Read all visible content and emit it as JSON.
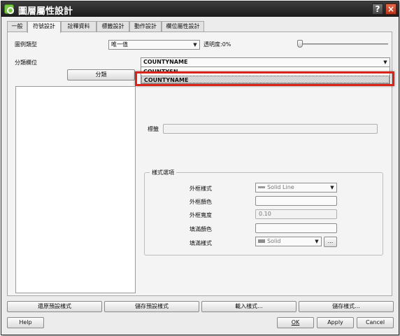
{
  "window": {
    "title": "圖層屬性設計",
    "help_glyph": "?",
    "close_glyph": "×",
    "app_icon": "qgis-logo-icon"
  },
  "tabs": [
    {
      "label": "一般",
      "active": false
    },
    {
      "label": "符號設計",
      "active": true
    },
    {
      "label": "詮釋資料",
      "active": false
    },
    {
      "label": "標籤設計",
      "active": false
    },
    {
      "label": "動作設計",
      "active": false
    },
    {
      "label": "欄位屬性設計",
      "active": false
    }
  ],
  "symbology": {
    "legend_type_label": "圖例類型",
    "legend_type_value": "唯一值",
    "transparency_label": "透明度:0%",
    "transparency_value": 0,
    "classification_field_label": "分類欄位",
    "classify_button": "分類",
    "field_combo_value": "COUNTYNAME",
    "field_options": [
      "COUNTYSN",
      "COUNTYNAME"
    ],
    "selected_option_index": 1,
    "label_label": "標籤",
    "label_value": ""
  },
  "style_options": {
    "group_title": "樣式選項",
    "outline_style_label": "外框樣式",
    "outline_style_value": "Solid Line",
    "outline_color_label": "外框顏色",
    "outline_width_label": "外框寬度",
    "outline_width_value": "0.10",
    "fill_color_label": "填滿顏色",
    "fill_style_label": "填滿樣式",
    "fill_style_value": "Solid",
    "ellipsis_button": "..."
  },
  "style_buttons": {
    "restore_default": "還原預設樣式",
    "save_default": "儲存預設樣式",
    "load_style": "載入樣式...",
    "save_style": "儲存樣式..."
  },
  "dialog_buttons": {
    "help": "Help",
    "ok": "OK",
    "apply": "Apply",
    "cancel": "Cancel"
  },
  "colors": {
    "highlight": "#d9241c",
    "titlebar": "#2b2b2b"
  }
}
